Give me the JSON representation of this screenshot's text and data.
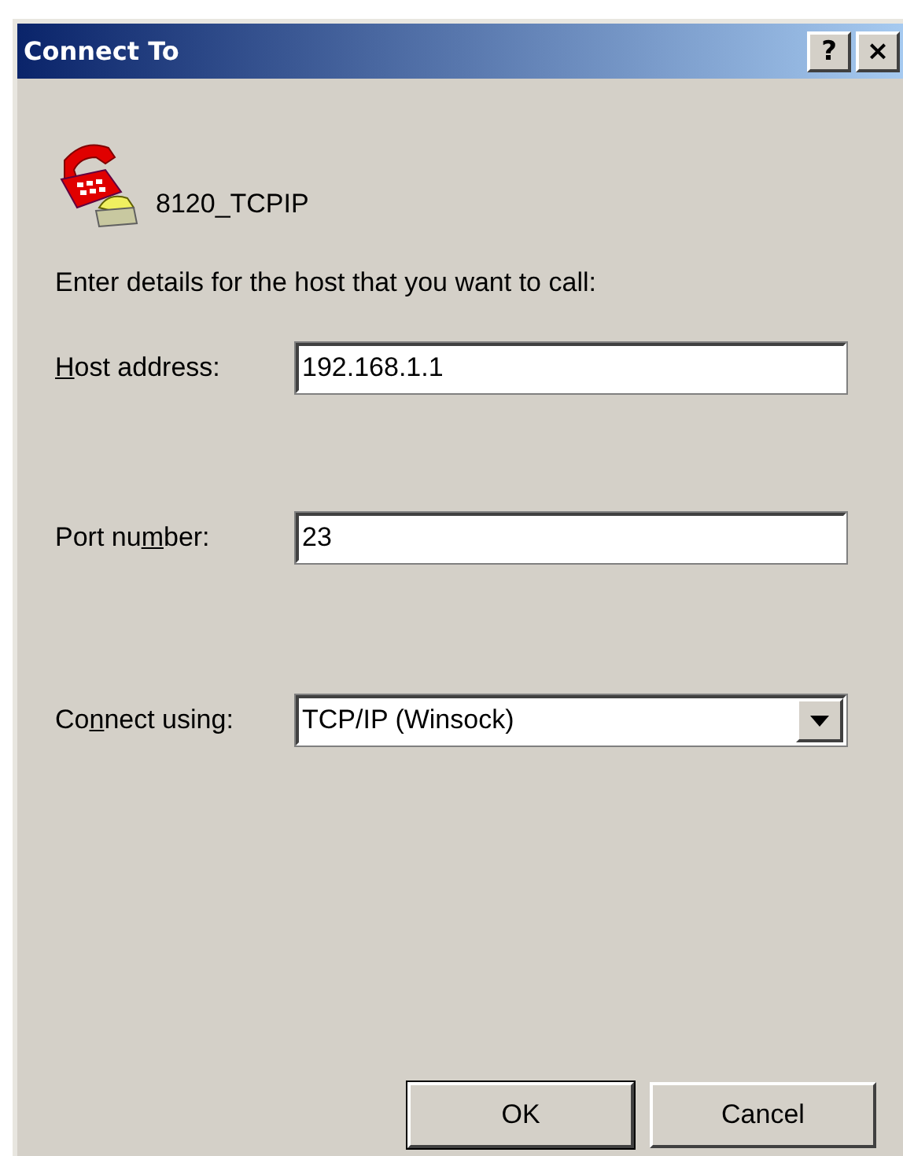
{
  "window": {
    "title": "Connect To",
    "help_button": "?",
    "close_button": "×"
  },
  "connection": {
    "name": "8120_TCPIP"
  },
  "instructions": "Enter details for the host that you want to call:",
  "fields": [
    {
      "kind": "text",
      "label": {
        "key": "H",
        "after": "ost address:"
      },
      "value": "192.168.1.1"
    },
    {
      "kind": "text",
      "label": {
        "before": "Port nu",
        "key": "m",
        "after": "ber:"
      },
      "value": "23"
    },
    {
      "kind": "dropdown",
      "label": {
        "before": "Co",
        "key": "n",
        "after": "nect using:"
      },
      "value": "TCP/IP (Winsock)"
    }
  ],
  "buttons": [
    {
      "label": "OK",
      "default": true
    },
    {
      "label": "Cancel",
      "default": false
    }
  ]
}
